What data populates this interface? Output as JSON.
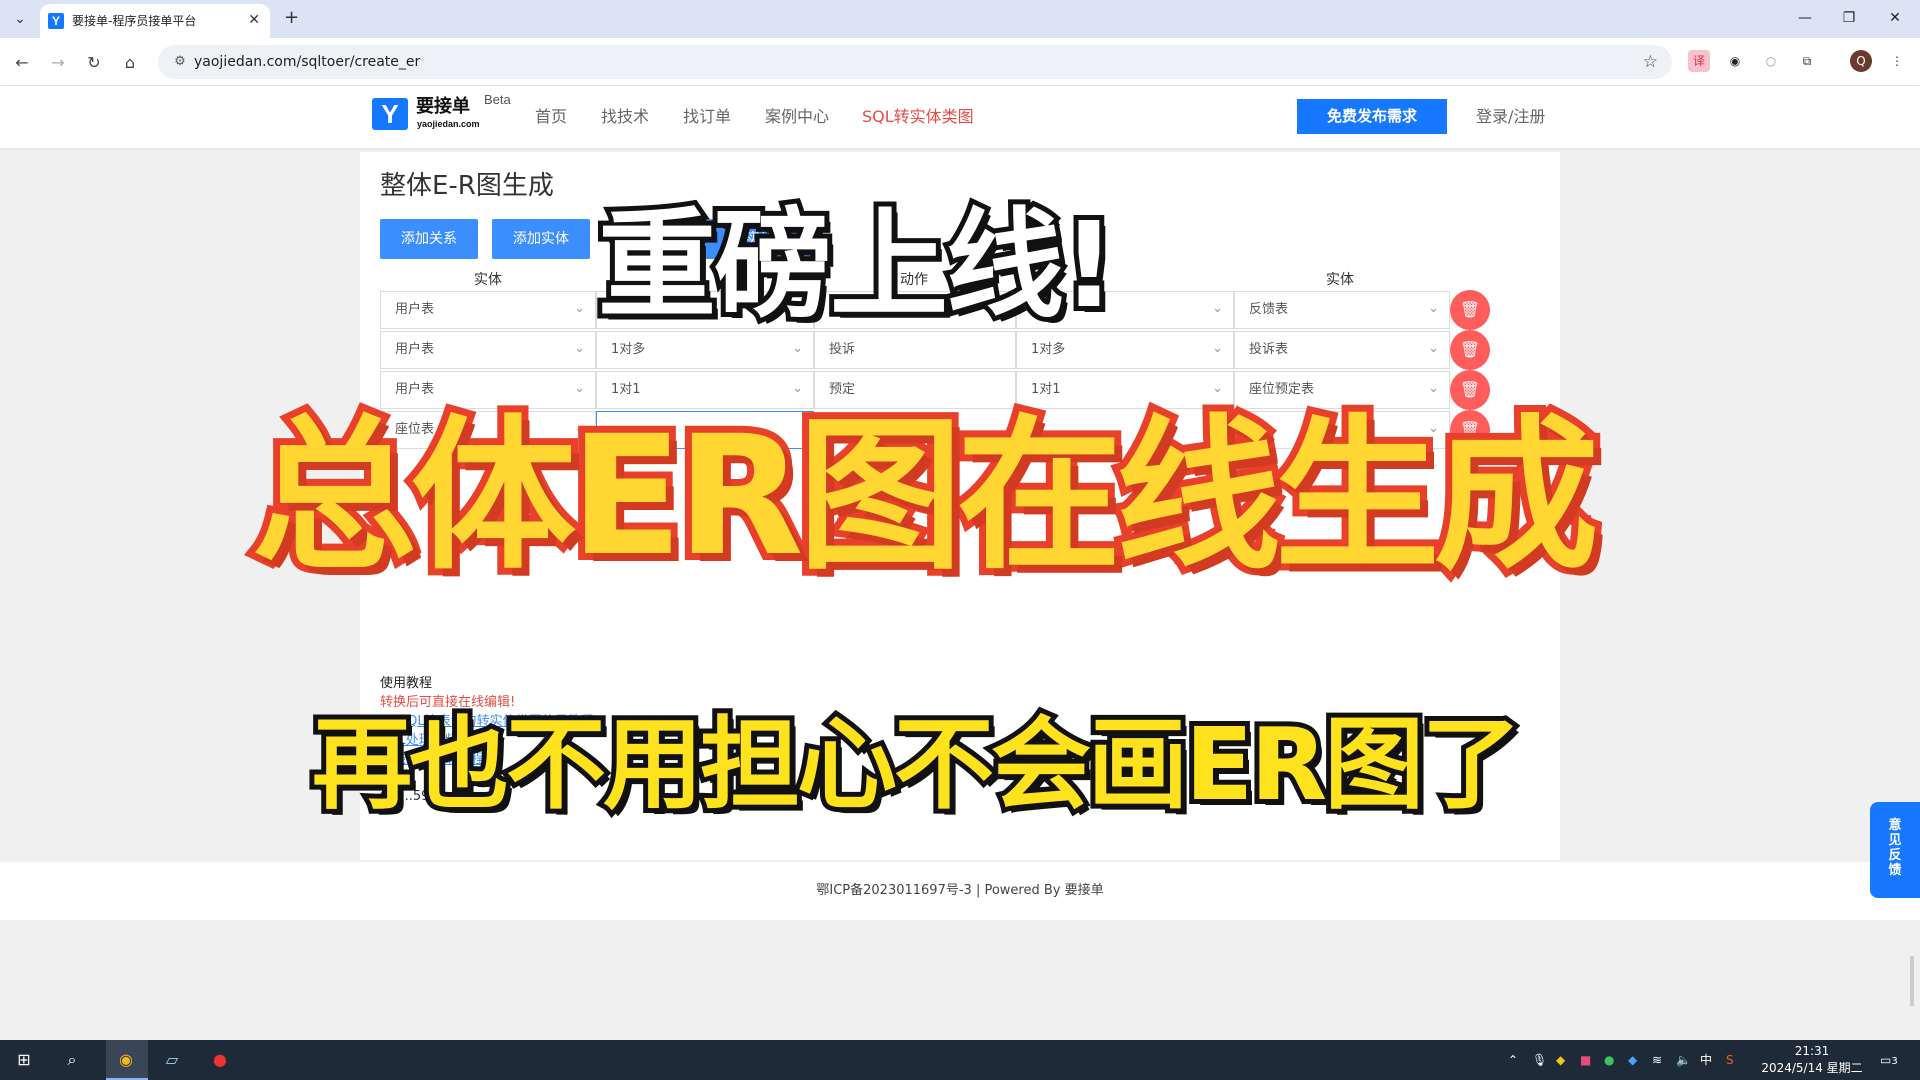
{
  "browser": {
    "tab_title": "要接单-程序员接单平台",
    "tab_favicon": "Y",
    "url": "yaojiedan.com/sqltoer/create_er",
    "profile_initial": "Q",
    "icons": [
      "tab-list-icon",
      "close-icon",
      "new-tab-icon",
      "minimize-icon",
      "restore-icon",
      "window-close-icon",
      "back-icon",
      "forward-icon",
      "reload-icon",
      "home-icon",
      "site-info-icon",
      "star-icon",
      "extensions-icon",
      "menu-icon"
    ]
  },
  "site": {
    "logo_letter": "Y",
    "logo_name": "要接单",
    "logo_domain": "yaojiedan.com",
    "logo_beta": "Beta",
    "nav": [
      "首页",
      "找技术",
      "找订单",
      "案例中心",
      "SQL转实体类图"
    ],
    "nav_active_index": 4,
    "publish_button": "免费发布需求",
    "login": "登录/注册",
    "accent_color": "#1677ff",
    "active_color": "#e54d42"
  },
  "main": {
    "title": "整体E-R图生成",
    "buttons": [
      "添加关系",
      "添加实体",
      "实体"
    ],
    "col_headers": [
      "实体",
      "动作",
      "实体"
    ],
    "rows": [
      {
        "left": "用户表",
        "rel_left": "",
        "action": "",
        "rel_right": "",
        "right": "反馈表"
      },
      {
        "left": "用户表",
        "rel_left": "1对多",
        "action": "投诉",
        "rel_right": "1对多",
        "right": "投诉表"
      },
      {
        "left": "用户表",
        "rel_left": "1对1",
        "action": "预定",
        "rel_right": "1对1",
        "right": "座位预定表"
      },
      {
        "left": "座位表",
        "rel_left": "",
        "action": "",
        "rel_right": "",
        "right": ""
      }
    ],
    "delete_icon": "trash-icon",
    "tutorial_head": "使用教程",
    "tutorial_note": "转换后可直接在线编辑!",
    "tutorial_links": [
      "MySQL建表语句转实体类图使用教程",
      "SQL处理视频教程",
      "在线编辑下载教程"
    ],
    "qq_fragment": "QQ...5949"
  },
  "footer": {
    "text": "鄂ICP备2023011697号-3 | Powered By 要接单"
  },
  "feedback_tab": "意见反馈",
  "overlay": {
    "line1": "重磅上线!",
    "line2": "总体ER图在线生成",
    "line3": "再也不用担心不会画ER图了"
  },
  "taskbar": {
    "ime": "中",
    "time": "21:31",
    "date": "2024/5/14 星期二",
    "notifications": "3"
  }
}
